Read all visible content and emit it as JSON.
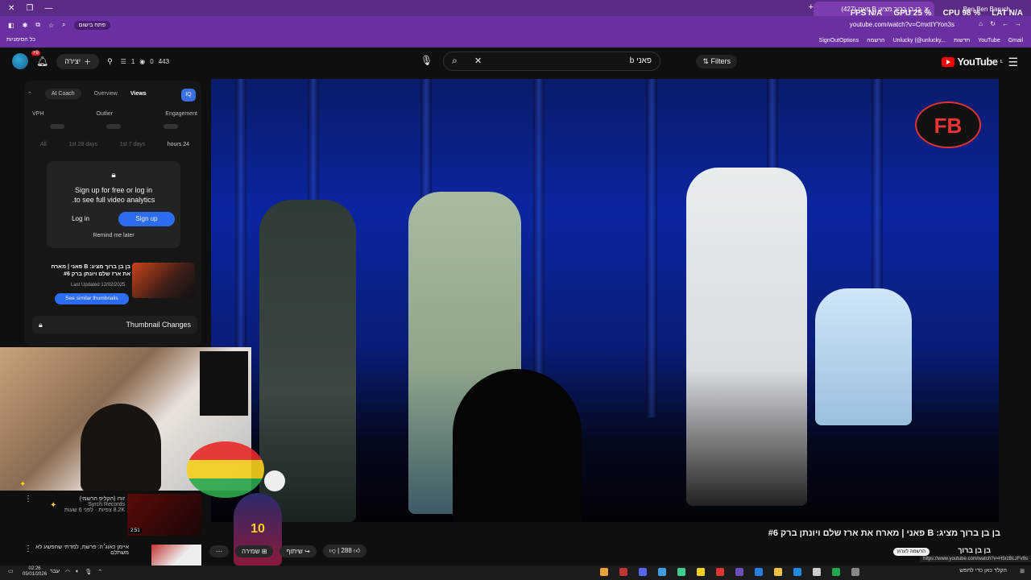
{
  "browser": {
    "tab1_title": "בן בן ברוך מציג: B פאני (427)",
    "tab2_title": "Ben Ben Baruch",
    "url": "youtube.com/watch?v=CmxttYYon3s",
    "newtab": "+",
    "pill_label": "פתח בישום",
    "bookmarks": [
      "SignOutOptions",
      "הרשמה",
      "Unlucky (@unlucky...",
      "חדשות",
      "YouTube",
      "Gmail"
    ],
    "all_bookmarks": "כל הסימניות"
  },
  "overlay": {
    "fps_label": "FPS",
    "fps_value": "N/A",
    "gpu_label": "GPU",
    "gpu_value": "25",
    "cpu_label": "CPU",
    "cpu_value": "98",
    "lat_label": "LAT",
    "lat_value": "N/A"
  },
  "youtube": {
    "logo_text": "YouTube",
    "logo_badge": "IL",
    "search_query": "b פאני",
    "filters_label": "Filters",
    "create_label": "יצירה",
    "notif_count": "+9",
    "stat_count1": "1",
    "stat_count2": "0",
    "stat_count3": "443"
  },
  "analytics": {
    "tabs": [
      "AI Coach",
      "Overview",
      "Views"
    ],
    "iq_label": "IQ",
    "metrics": [
      "VPH",
      "Outlier",
      "Engagement"
    ],
    "ranges": [
      "All",
      "1st 28 days",
      "1st 7 days",
      "hours 24"
    ],
    "lock_title": "Sign up for free or log in",
    "lock_sub": ".to see full video analytics",
    "login_label": "Log in",
    "signup_label": "Sign up",
    "remind_label": "Remind me later",
    "thumb_title": "בן בן ברוך מציג: B פאני | מארח את ארז שלם ויונתן ברק #6",
    "thumb_date": "Last Updated 12/02/2025",
    "similar_label": "See similar thumbnails",
    "thumb_changes": "Thumbnail Changes"
  },
  "video": {
    "title": "בן בן ברוך מציג: B פאני | מארח את ארז שלם ויונתן ברק #6",
    "channel": "בן בן ברוך",
    "subscribe_label": "הרשמה לערוץ",
    "likes": "288",
    "share_label": "שיתוף",
    "save_label": "שמירה",
    "logo_letters": "FB",
    "status_url": "https://www.youtube.com/watch?v=H5rzBLzFv9s"
  },
  "recommendations": [
    {
      "title": "זורו (הקליפ הרשמי)",
      "channel": "Syrch Records",
      "meta": "8.2K צפיות · לפני 6 שעות",
      "duration": "2:51"
    },
    {
      "title": "איימן כאוג׳ה: פרשת, למדתי שהפשע לא משתלם",
      "channel": "",
      "meta": "",
      "duration": ""
    }
  ],
  "taskbar": {
    "time": "02:26",
    "date": "05/01/2026",
    "lang": "עבר",
    "search_placeholder": "הקלד כאן כדי לחפש"
  },
  "colors": {
    "chrome_purple": "#6a2fa0",
    "yt_red": "#ff0000",
    "accent_blue": "#2b6cf0"
  }
}
